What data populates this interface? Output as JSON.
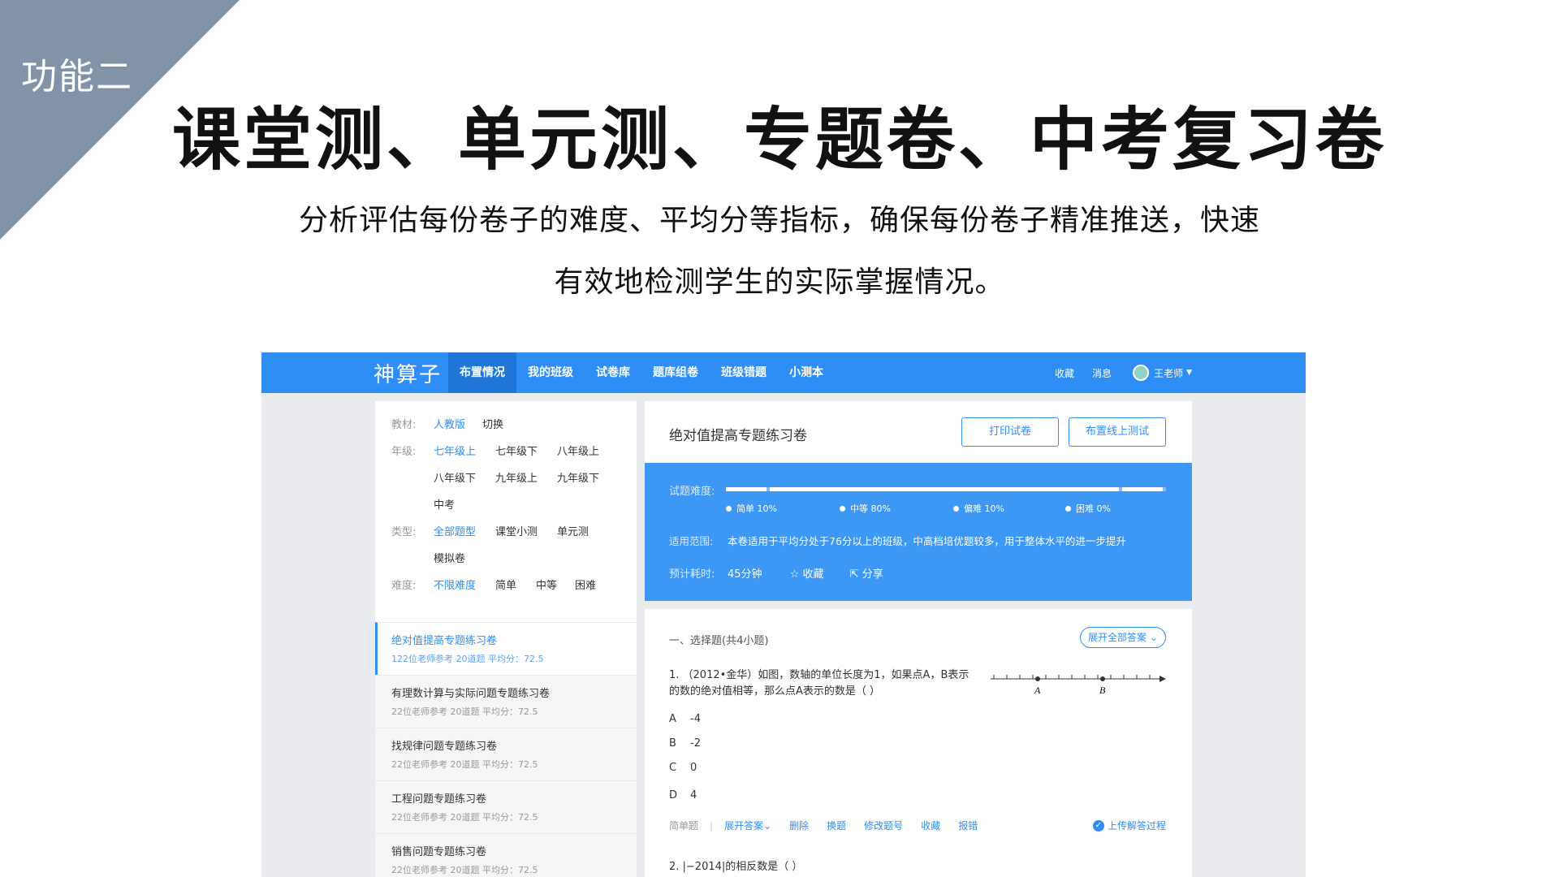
{
  "slide": {
    "corner_label": "功能二",
    "title": "课堂测、单元测、专题卷、中考复习卷",
    "subtitle_line1": "分析评估每份卷子的难度、平均分等指标，确保每份卷子精准推送，快速",
    "subtitle_line2": "有效地检测学生的实际掌握情况。"
  },
  "app": {
    "brand": "神算子",
    "nav": [
      "布置情况",
      "我的班级",
      "试卷库",
      "题库组卷",
      "班级错题",
      "小测本"
    ],
    "top_right": {
      "favorites": "收藏",
      "messages": "消息",
      "user": "王老师"
    },
    "filters": {
      "textbook": {
        "label": "教材:",
        "selected": "人教版",
        "switch": "切换"
      },
      "grade": {
        "label": "年级:",
        "options": [
          "七年级上",
          "七年级下",
          "八年级上",
          "八年级下",
          "九年级上",
          "九年级下",
          "中考"
        ]
      },
      "type": {
        "label": "类型:",
        "options": [
          "全部题型",
          "课堂小测",
          "单元测",
          "模拟卷"
        ]
      },
      "difficulty": {
        "label": "难度:",
        "options": [
          "不限难度",
          "简单",
          "中等",
          "困难"
        ]
      }
    },
    "papers": [
      {
        "title": "绝对值提高专题练习卷",
        "meta": "122位老师参考  20道题  平均分：72.5"
      },
      {
        "title": "有理数计算与实际问题专题练习卷",
        "meta": "22位老师参考  20道题  平均分：72.5"
      },
      {
        "title": "找规律问题专题练习卷",
        "meta": "22位老师参考  20道题  平均分：72.5"
      },
      {
        "title": "工程问题专题练习卷",
        "meta": "22位老师参考  20道题  平均分：72.5"
      },
      {
        "title": "销售问题专题练习卷",
        "meta": "22位老师参考  20道题  平均分：72.5"
      }
    ],
    "detail": {
      "title": "绝对值提高专题练习卷",
      "print_button": "打印试卷",
      "assign_button": "布置线上测试",
      "difficulty_label": "试题难度:",
      "difficulty": [
        {
          "label": "简单 10%",
          "fraction": 0.1
        },
        {
          "label": "中等 80%",
          "fraction": 0.8
        },
        {
          "label": "偏难 10%",
          "fraction": 0.1
        },
        {
          "label": "困难 0%",
          "fraction": 0.0
        }
      ],
      "scope_label": "适用范围:",
      "scope": "本卷适用于平均分处于76分以上的班级，中高档培优题较多，用于整体水平的进一步提升",
      "time_label": "预计耗时:",
      "time": "45分钟",
      "favorite": "收藏",
      "share": "分享"
    },
    "questions": {
      "section": "一、选择题(共4小题)",
      "expand_all": "展开全部答案",
      "q1_line1": "1. （2012•金华）如图，数轴的单位长度为1，如果点A，B表示",
      "q1_line2": "的数的绝对值相等，那么点A表示的数是（      ）",
      "point_a": "A",
      "point_b": "B",
      "options": [
        {
          "key": "A",
          "value": "-4"
        },
        {
          "key": "B",
          "value": "-2"
        },
        {
          "key": "C",
          "value": "0"
        },
        {
          "key": "D",
          "value": "4"
        }
      ],
      "toolbar": {
        "kind": "简单题",
        "expand": "展开答案",
        "delete": "删除",
        "replace": "换题",
        "renumber": "修改题号",
        "favorite": "收藏",
        "report": "报错",
        "upload": "上传解答过程"
      },
      "q2": "2. |−2014|的相反数是（      ）"
    }
  }
}
